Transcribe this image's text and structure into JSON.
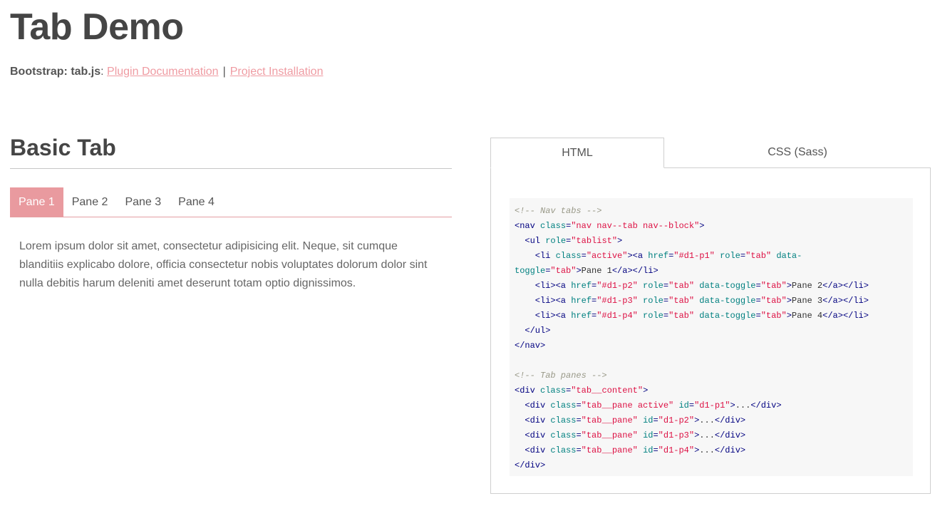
{
  "header": {
    "title": "Tab Demo",
    "label": "Bootstrap: tab.js",
    "colon": ":",
    "link_docs": "Plugin Documentation",
    "separator": "|",
    "link_install": "Project Installation"
  },
  "section": {
    "title": "Basic Tab",
    "tabs": [
      {
        "label": "Pane 1",
        "active": true
      },
      {
        "label": "Pane 2",
        "active": false
      },
      {
        "label": "Pane 3",
        "active": false
      },
      {
        "label": "Pane 4",
        "active": false
      }
    ],
    "pane_text": "Lorem ipsum dolor sit amet, consectetur adipisicing elit. Neque, sit cumque blanditiis explicabo dolore, officia consectetur nobis voluptates dolorum dolor sint nulla debitis harum deleniti amet deserunt totam optio dignissimos."
  },
  "code_panel": {
    "tabs": [
      {
        "label": "HTML",
        "active": true
      },
      {
        "label": "CSS (Sass)",
        "active": false
      }
    ],
    "lines": [
      [
        [
          "com",
          "<!-- Nav tabs -->"
        ]
      ],
      [
        [
          "tag",
          "<nav "
        ],
        [
          "attr",
          "class"
        ],
        [
          "tag",
          "="
        ],
        [
          "val",
          "\"nav nav--tab nav--block\""
        ],
        [
          "tag",
          ">"
        ]
      ],
      [
        [
          "tag",
          "  <ul "
        ],
        [
          "attr",
          "role"
        ],
        [
          "tag",
          "="
        ],
        [
          "val",
          "\"tablist\""
        ],
        [
          "tag",
          ">"
        ]
      ],
      [
        [
          "tag",
          "    <li "
        ],
        [
          "attr",
          "class"
        ],
        [
          "tag",
          "="
        ],
        [
          "val",
          "\"active\""
        ],
        [
          "tag",
          "><a "
        ],
        [
          "attr",
          "href"
        ],
        [
          "tag",
          "="
        ],
        [
          "val",
          "\"#d1-p1\""
        ],
        [
          "tag",
          " "
        ],
        [
          "attr",
          "role"
        ],
        [
          "tag",
          "="
        ],
        [
          "val",
          "\"tab\""
        ],
        [
          "tag",
          " "
        ],
        [
          "attr",
          "data-"
        ]
      ],
      [
        [
          "attr",
          "toggle"
        ],
        [
          "tag",
          "="
        ],
        [
          "val",
          "\"tab\""
        ],
        [
          "tag",
          ">"
        ],
        [
          "text",
          "Pane 1"
        ],
        [
          "tag",
          "</a></li>"
        ]
      ],
      [
        [
          "tag",
          "    <li><a "
        ],
        [
          "attr",
          "href"
        ],
        [
          "tag",
          "="
        ],
        [
          "val",
          "\"#d1-p2\""
        ],
        [
          "tag",
          " "
        ],
        [
          "attr",
          "role"
        ],
        [
          "tag",
          "="
        ],
        [
          "val",
          "\"tab\""
        ],
        [
          "tag",
          " "
        ],
        [
          "attr",
          "data-toggle"
        ],
        [
          "tag",
          "="
        ],
        [
          "val",
          "\"tab\""
        ],
        [
          "tag",
          ">"
        ],
        [
          "text",
          "Pane 2"
        ],
        [
          "tag",
          "</a></li>"
        ]
      ],
      [
        [
          "tag",
          "    <li><a "
        ],
        [
          "attr",
          "href"
        ],
        [
          "tag",
          "="
        ],
        [
          "val",
          "\"#d1-p3\""
        ],
        [
          "tag",
          " "
        ],
        [
          "attr",
          "role"
        ],
        [
          "tag",
          "="
        ],
        [
          "val",
          "\"tab\""
        ],
        [
          "tag",
          " "
        ],
        [
          "attr",
          "data-toggle"
        ],
        [
          "tag",
          "="
        ],
        [
          "val",
          "\"tab\""
        ],
        [
          "tag",
          ">"
        ],
        [
          "text",
          "Pane 3"
        ],
        [
          "tag",
          "</a></li>"
        ]
      ],
      [
        [
          "tag",
          "    <li><a "
        ],
        [
          "attr",
          "href"
        ],
        [
          "tag",
          "="
        ],
        [
          "val",
          "\"#d1-p4\""
        ],
        [
          "tag",
          " "
        ],
        [
          "attr",
          "role"
        ],
        [
          "tag",
          "="
        ],
        [
          "val",
          "\"tab\""
        ],
        [
          "tag",
          " "
        ],
        [
          "attr",
          "data-toggle"
        ],
        [
          "tag",
          "="
        ],
        [
          "val",
          "\"tab\""
        ],
        [
          "tag",
          ">"
        ],
        [
          "text",
          "Pane 4"
        ],
        [
          "tag",
          "</a></li>"
        ]
      ],
      [
        [
          "tag",
          "  </ul>"
        ]
      ],
      [
        [
          "tag",
          "</nav>"
        ]
      ],
      [
        [
          "text",
          ""
        ]
      ],
      [
        [
          "com",
          "<!-- Tab panes -->"
        ]
      ],
      [
        [
          "tag",
          "<div "
        ],
        [
          "attr",
          "class"
        ],
        [
          "tag",
          "="
        ],
        [
          "val",
          "\"tab__content\""
        ],
        [
          "tag",
          ">"
        ]
      ],
      [
        [
          "tag",
          "  <div "
        ],
        [
          "attr",
          "class"
        ],
        [
          "tag",
          "="
        ],
        [
          "val",
          "\"tab__pane active\""
        ],
        [
          "tag",
          " "
        ],
        [
          "attr",
          "id"
        ],
        [
          "tag",
          "="
        ],
        [
          "val",
          "\"d1-p1\""
        ],
        [
          "tag",
          ">"
        ],
        [
          "text",
          "..."
        ],
        [
          "tag",
          "</div>"
        ]
      ],
      [
        [
          "tag",
          "  <div "
        ],
        [
          "attr",
          "class"
        ],
        [
          "tag",
          "="
        ],
        [
          "val",
          "\"tab__pane\""
        ],
        [
          "tag",
          " "
        ],
        [
          "attr",
          "id"
        ],
        [
          "tag",
          "="
        ],
        [
          "val",
          "\"d1-p2\""
        ],
        [
          "tag",
          ">"
        ],
        [
          "text",
          "..."
        ],
        [
          "tag",
          "</div>"
        ]
      ],
      [
        [
          "tag",
          "  <div "
        ],
        [
          "attr",
          "class"
        ],
        [
          "tag",
          "="
        ],
        [
          "val",
          "\"tab__pane\""
        ],
        [
          "tag",
          " "
        ],
        [
          "attr",
          "id"
        ],
        [
          "tag",
          "="
        ],
        [
          "val",
          "\"d1-p3\""
        ],
        [
          "tag",
          ">"
        ],
        [
          "text",
          "..."
        ],
        [
          "tag",
          "</div>"
        ]
      ],
      [
        [
          "tag",
          "  <div "
        ],
        [
          "attr",
          "class"
        ],
        [
          "tag",
          "="
        ],
        [
          "val",
          "\"tab__pane\""
        ],
        [
          "tag",
          " "
        ],
        [
          "attr",
          "id"
        ],
        [
          "tag",
          "="
        ],
        [
          "val",
          "\"d1-p4\""
        ],
        [
          "tag",
          ">"
        ],
        [
          "text",
          "..."
        ],
        [
          "tag",
          "</div>"
        ]
      ],
      [
        [
          "tag",
          "</div>"
        ]
      ]
    ]
  },
  "colors": {
    "accent": "#e99a9f",
    "link": "#ef9ba2",
    "code_bg": "#f7f7f7"
  }
}
